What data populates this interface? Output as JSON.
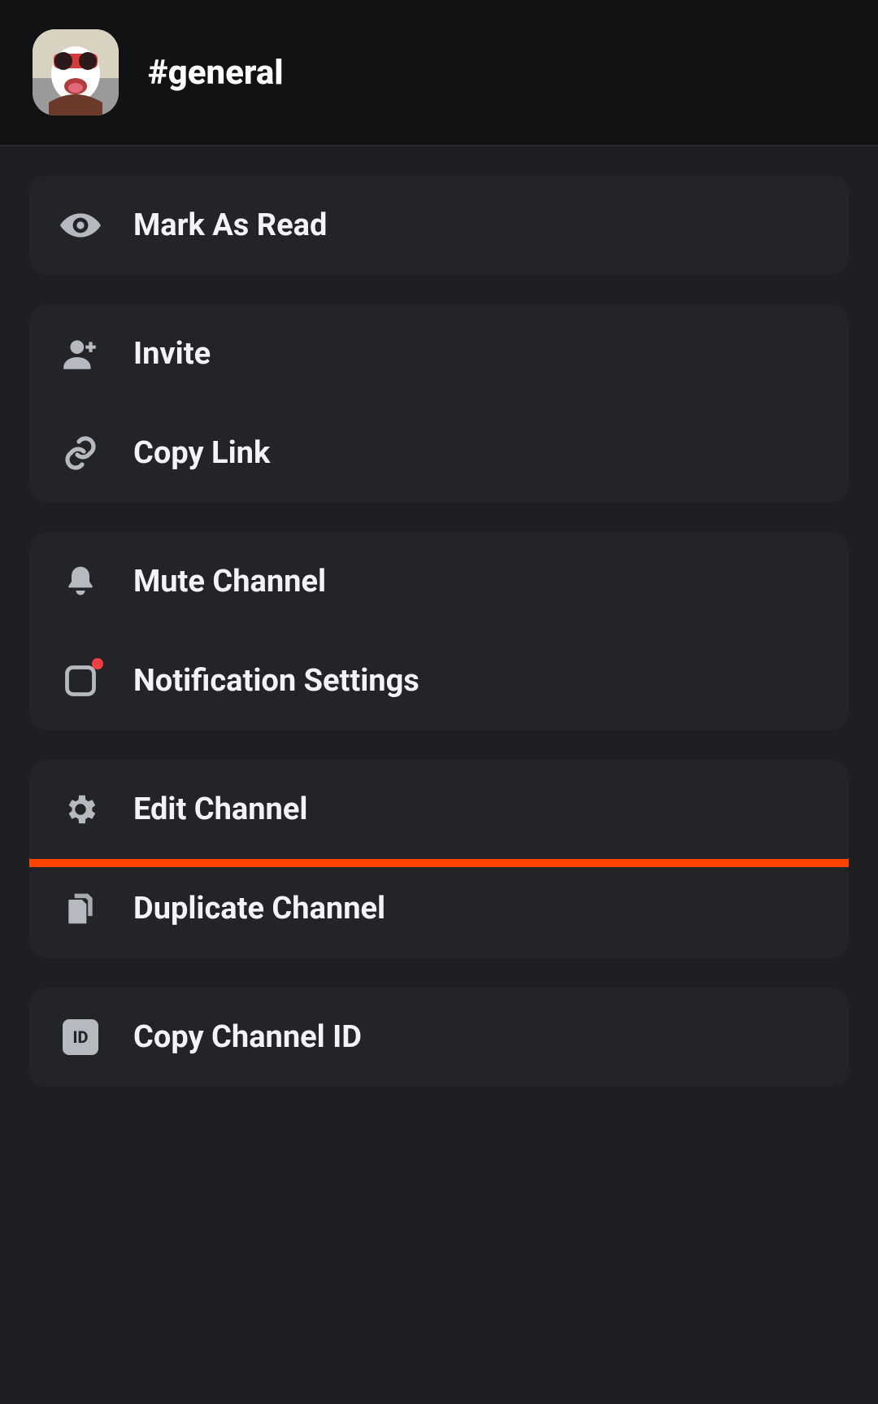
{
  "header": {
    "channel_name": "#general"
  },
  "menu": {
    "mark_as_read": "Mark As Read",
    "invite": "Invite",
    "copy_link": "Copy Link",
    "mute_channel": "Mute Channel",
    "notification_settings": "Notification Settings",
    "edit_channel": "Edit Channel",
    "duplicate_channel": "Duplicate Channel",
    "copy_channel_id": "Copy Channel ID",
    "id_chip_text": "ID"
  },
  "icons": {
    "eye": "eye-icon",
    "person_add": "person-add-icon",
    "link": "link-icon",
    "bell": "bell-icon",
    "notification_box": "notification-box-icon",
    "gear": "gear-icon",
    "duplicate": "duplicate-icon",
    "id": "id-icon"
  },
  "highlight": {
    "target": "edit_channel",
    "color": "#ff4500"
  }
}
